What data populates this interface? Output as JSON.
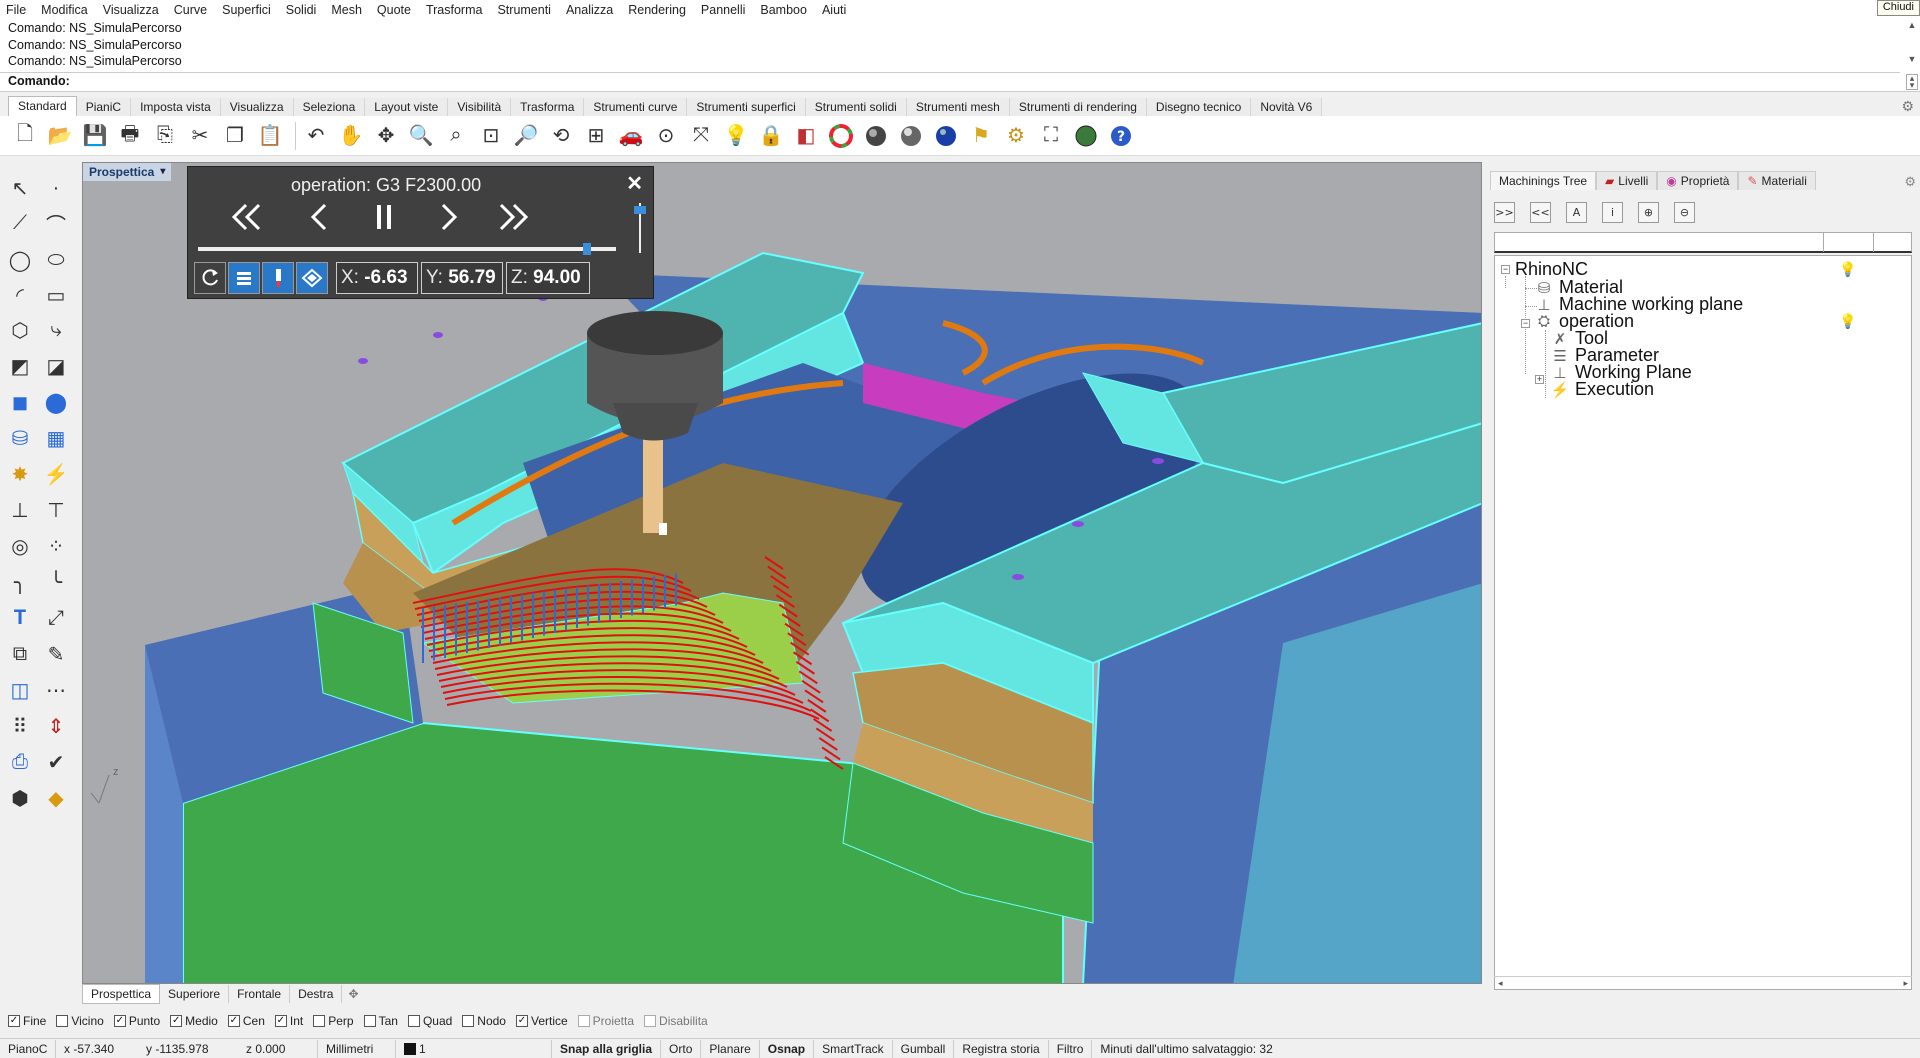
{
  "menu": {
    "items": [
      "File",
      "Modifica",
      "Visualizza",
      "Curve",
      "Superfici",
      "Solidi",
      "Mesh",
      "Quote",
      "Trasforma",
      "Strumenti",
      "Analizza",
      "Rendering",
      "Pannelli",
      "Bamboo",
      "Aiuti"
    ],
    "close_label": "Chiudi"
  },
  "command": {
    "history": [
      "Comando: NS_SimulaPercorso",
      "Comando: NS_SimulaPercorso",
      "Comando: NS_SimulaPercorso"
    ],
    "prompt": "Comando:"
  },
  "toolbar_tabs": [
    "Standard",
    "PianiC",
    "Imposta vista",
    "Visualizza",
    "Seleziona",
    "Layout viste",
    "Visibilità",
    "Trasforma",
    "Strumenti curve",
    "Strumenti superfici",
    "Strumenti solidi",
    "Strumenti mesh",
    "Strumenti di rendering",
    "Disegno tecnico",
    "Novità V6"
  ],
  "toolbar_icons": [
    "new-icon",
    "open-icon",
    "save-icon",
    "print-icon",
    "import-icon",
    "cut-icon",
    "copy-icon",
    "paste-icon",
    "undo-icon",
    "pan-icon",
    "rotate-view-icon",
    "zoom-icon",
    "zoom-window-icon",
    "zoom-extents-icon",
    "zoom-selected-icon",
    "rotate-3d-icon",
    "four-viewports-icon",
    "car-render-icon",
    "osnap-icon",
    "gumball-icon",
    "light-icon",
    "lock-icon",
    "layer-icon",
    "color-wheel-icon",
    "shaded-sphere-icon",
    "rendered-sphere-icon",
    "blue-sphere-icon",
    "flag-icon",
    "gear-icon",
    "block-icon",
    "globe-icon",
    "help-icon"
  ],
  "viewport": {
    "title": "Prospettica",
    "axis_label": "z",
    "tabs": [
      "Prospettica",
      "Superiore",
      "Frontale",
      "Destra"
    ],
    "add_tab": "✥"
  },
  "simulation": {
    "title": "operation: G3 F2300.00",
    "progress": 0.93,
    "speed": 0.95,
    "x_label": "X:",
    "x_value": "-6.63",
    "y_label": "Y:",
    "y_value": "56.79",
    "z_label": "Z:",
    "z_value": "94.00"
  },
  "panel": {
    "tabs": [
      "Machinings Tree",
      "Livelli",
      "Proprietà",
      "Materiali"
    ],
    "toolbar": [
      ">>",
      "<<",
      "A",
      "i",
      "⊕",
      "⊖"
    ],
    "tree": {
      "root": "RhinoNC",
      "material": "Material",
      "machine_plane": "Machine working plane",
      "operation": "operation",
      "tool": "Tool",
      "parameter": "Parameter",
      "working_plane": "Working Plane",
      "execution": "Execution"
    }
  },
  "osnap": [
    {
      "label": "Fine",
      "checked": true
    },
    {
      "label": "Vicino",
      "checked": false
    },
    {
      "label": "Punto",
      "checked": true
    },
    {
      "label": "Medio",
      "checked": true
    },
    {
      "label": "Cen",
      "checked": true
    },
    {
      "label": "Int",
      "checked": true
    },
    {
      "label": "Perp",
      "checked": false
    },
    {
      "label": "Tan",
      "checked": false
    },
    {
      "label": "Quad",
      "checked": false
    },
    {
      "label": "Nodo",
      "checked": false
    },
    {
      "label": "Vertice",
      "checked": true
    },
    {
      "label": "Proietta",
      "checked": false
    },
    {
      "label": "Disabilita",
      "checked": false
    }
  ],
  "status": {
    "plane": "PianoC",
    "x": "x -57.340",
    "y": "y -1135.978",
    "z": "z 0.000",
    "units": "Millimetri",
    "layer": "1",
    "snap": "Snap alla griglia",
    "orto": "Orto",
    "planare": "Planare",
    "osnap": "Osnap",
    "smarttrack": "SmartTrack",
    "gumball": "Gumball",
    "history": "Registra storia",
    "filter": "Filtro",
    "saved": "Minuti dall'ultimo salvataggio: 32"
  },
  "colors": {
    "toolpath": "#e01010",
    "cyan": "#63e6e2",
    "green": "#3fa84a",
    "blue": "#4a6fb5",
    "tan": "#c9a05a",
    "magenta": "#c83cc0",
    "orange": "#e07a10"
  }
}
